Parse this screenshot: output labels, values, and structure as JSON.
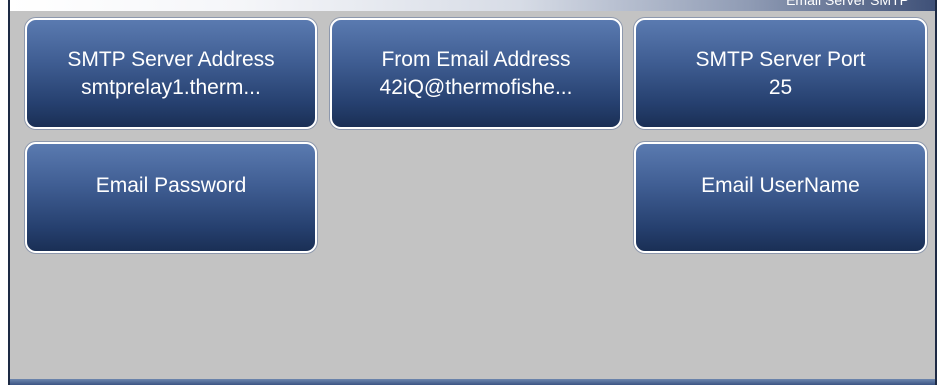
{
  "header": {
    "title": "Email Server SMTP"
  },
  "buttons": {
    "smtp_server_address": {
      "label": "SMTP Server Address",
      "value": "smtprelay1.therm..."
    },
    "from_email_address": {
      "label": "From Email Address",
      "value": "42iQ@thermofishe..."
    },
    "smtp_server_port": {
      "label": "SMTP Server Port",
      "value": "25"
    },
    "email_password": {
      "label": "Email Password"
    },
    "email_username": {
      "label": "Email UserName"
    }
  },
  "colors": {
    "background": "#c3c3c3",
    "button_top": "#5a7ab0",
    "button_bottom": "#1a2f55",
    "button_border": "#ffffff",
    "text": "#ffffff"
  }
}
